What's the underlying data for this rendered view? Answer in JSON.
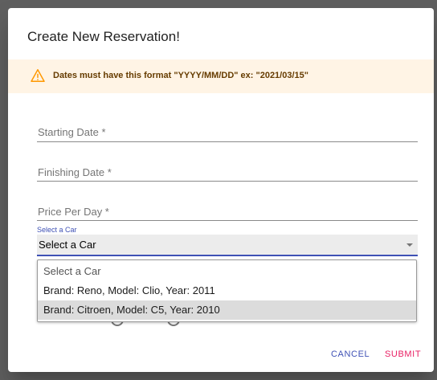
{
  "dialog": {
    "title": "Create New Reservation!",
    "alert": "Dates must have this format \"YYYY/MM/DD\" ex: \"2021/03/15\"",
    "fields": {
      "starting_date": "Starting Date *",
      "finishing_date": "Finishing Date *",
      "price_per_day": "Price Per Day *"
    },
    "car_select": {
      "label": "Select a Car",
      "value": "Select a Car",
      "options": [
        "Select a Car",
        "Brand: Reno, Model: Clio, Year: 2011",
        "Brand: Citroen, Model: C5, Year: 2010"
      ]
    },
    "actions": {
      "cancel": "CANCEL",
      "submit": "SUBMIT"
    }
  },
  "colors": {
    "backdrop": "#5f5f5f",
    "alert_bg": "#fff4e5",
    "alert_text": "#663c00",
    "warning_icon": "#ff9800",
    "primary": "#3f51b5",
    "secondary": "#e91e63"
  },
  "icons": {
    "alert": "warning-icon",
    "select": "dropdown-arrow-icon"
  }
}
